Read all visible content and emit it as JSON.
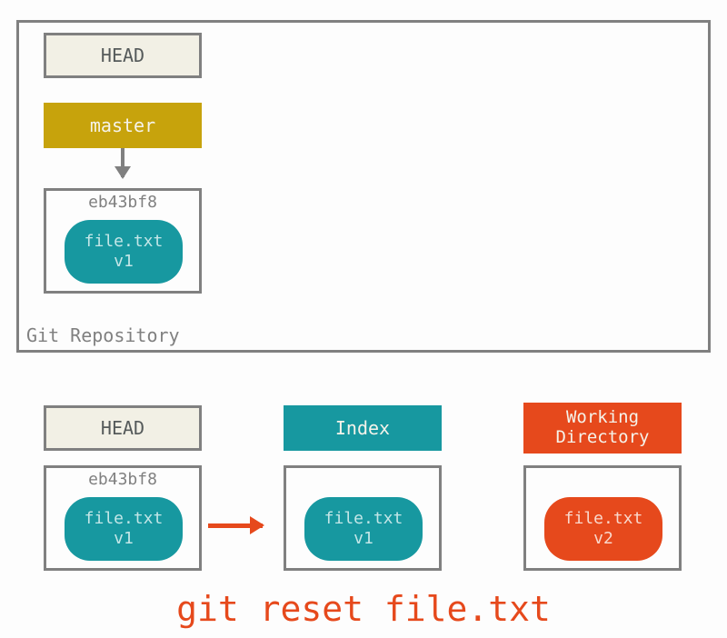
{
  "repo": {
    "label": "Git Repository",
    "head_label": "HEAD",
    "branch_label": "master",
    "commit": {
      "hash": "eb43bf8",
      "file": "file.txt",
      "version": "v1"
    }
  },
  "areas": {
    "head": {
      "label": "HEAD",
      "commit": {
        "hash": "eb43bf8",
        "file": "file.txt",
        "version": "v1"
      }
    },
    "index": {
      "label": "Index",
      "file": "file.txt",
      "version": "v1"
    },
    "working_directory": {
      "label": "Working\nDirectory",
      "file": "file.txt",
      "version": "v2"
    }
  },
  "command": "git reset file.txt",
  "colors": {
    "teal": "#1798a0",
    "orange": "#e6491c",
    "mustard": "#c7a30c",
    "gray": "#808080",
    "cream": "#f2f0e5"
  }
}
